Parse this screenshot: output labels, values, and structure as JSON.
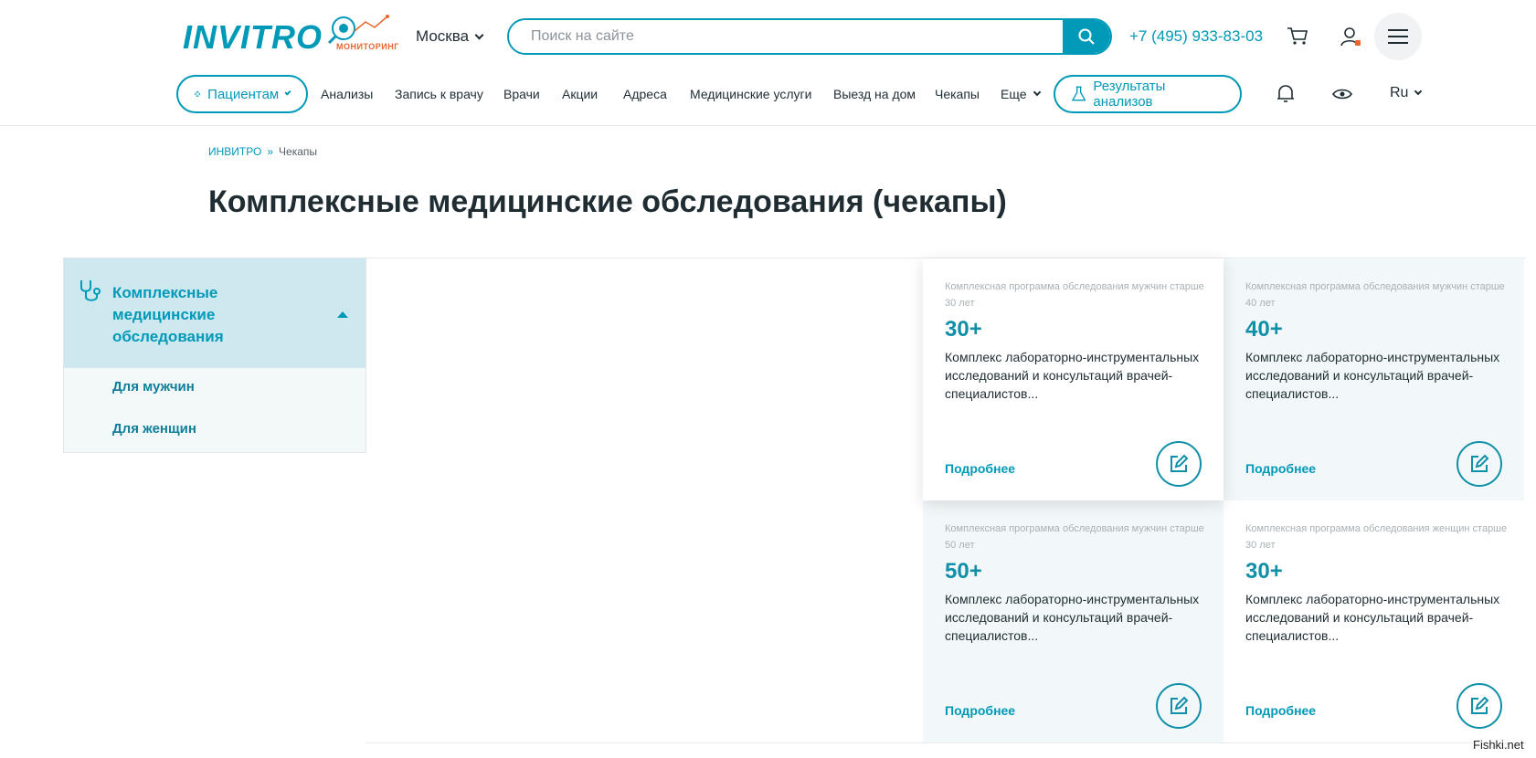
{
  "header": {
    "logo": "INVITRO",
    "monitor_label": "МОНИТОРИНГ",
    "city": "Москва",
    "search_placeholder": "Поиск на сайте",
    "phone": "+7 (495) 933-83-03"
  },
  "nav": {
    "patients": "Пациентам",
    "items": [
      "Анализы",
      "Запись к врачу",
      "Врачи",
      "Акции",
      "Адреса",
      "Медицинские услуги",
      "Выезд на дом",
      "Чекапы",
      "Еще"
    ],
    "results": "Результаты анализов",
    "lang": "Ru"
  },
  "breadcrumb": {
    "home": "ИНВИТРО",
    "separator": "»",
    "current": "Чекапы"
  },
  "page_title": "Комплексные медицинские обследования (чекапы)",
  "sidebar": {
    "title": "Комплексные медицинские обследования",
    "links": [
      "Для мужчин",
      "Для женщин"
    ]
  },
  "cards": [
    {
      "subtitle": "Комплексная программа обследования мужчин старше 30 лет",
      "age": "30+",
      "description": "Комплекс лабораторно-инструментальных исследований и консультаций врачей-специалистов...",
      "more": "Подробнее"
    },
    {
      "subtitle": "Комплексная программа обследования мужчин старше 40 лет",
      "age": "40+",
      "description": "Комплекс лабораторно-инструментальных исследований и консультаций врачей-специалистов...",
      "more": "Подробнее"
    },
    {
      "subtitle": "Комплексная программа обследования мужчин старше 50 лет",
      "age": "50+",
      "description": "Комплекс лабораторно-инструментальных исследований и консультаций врачей-специалистов...",
      "more": "Подробнее"
    },
    {
      "subtitle": "Комплексная программа обследования женщин старше 30 лет",
      "age": "30+",
      "description": "Комплекс лабораторно-инструментальных исследований и консультаций врачей-специалистов...",
      "more": "Подробнее"
    }
  ],
  "watermark": "Fishki.net",
  "colors": {
    "accent": "#0099b8",
    "sidebar_active": "#cde9ef",
    "card_bg": "#f2f8f9"
  }
}
